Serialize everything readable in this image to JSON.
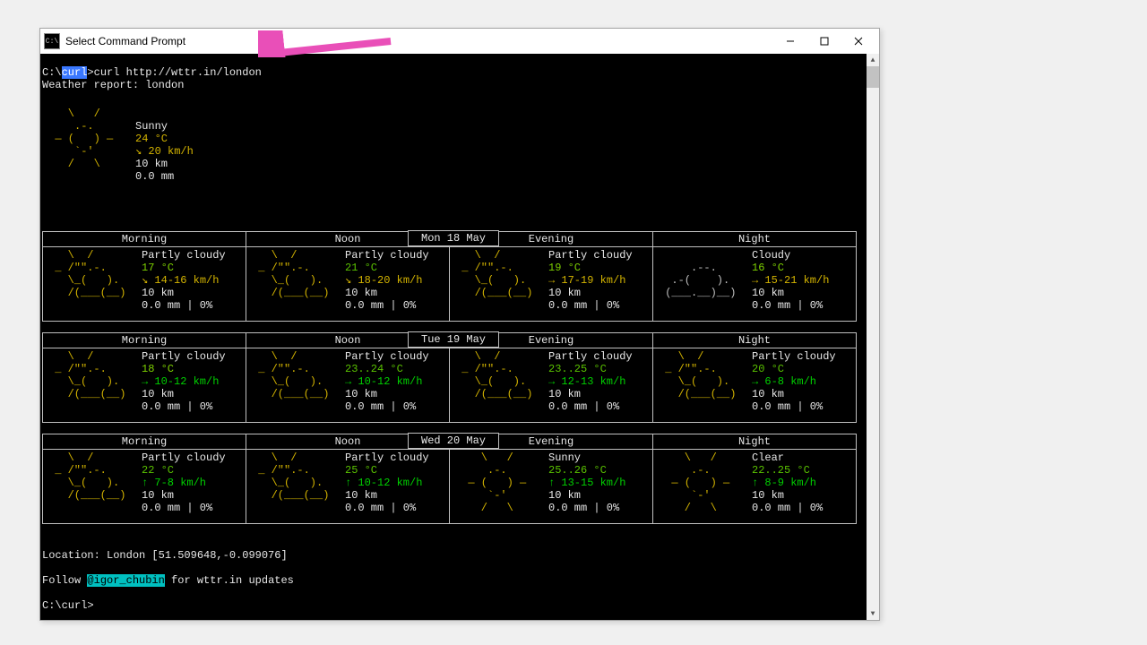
{
  "window": {
    "title": "Select Command Prompt"
  },
  "prompt": {
    "path_prefix": "C:\\",
    "selected_segment": "curl",
    "suffix": ">curl http://wttr.in/london",
    "report_header": "Weather report: london",
    "final_prompt": "C:\\curl>"
  },
  "current": {
    "ascii": "    \\   /    \n     .-.     \n  ― (   ) ―  \n     `-'     \n    /   \\    ",
    "cond": "Sunny",
    "temp": "24 °C",
    "wind": "↘ 20 km/h",
    "vis": "10 km",
    "rain": "0.0 mm"
  },
  "ascii": {
    "partly": "   \\  /      \n _ /\"\".-.    \n   \\_(   ).  \n   /(___(__) \n             ",
    "cloudy": "             \n     .--.    \n  .-(    ).  \n (___.__)__) \n             ",
    "sunny": "    \\   /    \n     .-.     \n  ― (   ) ―  \n     `-'     \n    /   \\    "
  },
  "headers": {
    "morning": "Morning",
    "noon": "Noon",
    "evening": "Evening",
    "night": "Night"
  },
  "days": [
    {
      "date": "Mon 18 May",
      "cells": [
        {
          "icon": "partly",
          "cond": "Partly cloudy",
          "tcls": "lime",
          "temp": "17 °C",
          "wcls": "yellow",
          "wind": "↘ 14-16 km/h",
          "vis": "10 km",
          "rain": "0.0 mm | 0%"
        },
        {
          "icon": "partly",
          "cond": "Partly cloudy",
          "tcls": "greenish",
          "temp": "21 °C",
          "wcls": "yellow",
          "wind": "↘ 18-20 km/h",
          "vis": "10 km",
          "rain": "0.0 mm | 0%"
        },
        {
          "icon": "partly",
          "cond": "Partly cloudy",
          "tcls": "lime",
          "temp": "19 °C",
          "wcls": "yellow",
          "wind": "→ 17-19 km/h",
          "vis": "10 km",
          "rain": "0.0 mm | 0%"
        },
        {
          "icon": "cloudy",
          "cond": "Cloudy",
          "tcls": "lime",
          "temp": "16 °C",
          "wcls": "yellow",
          "wind": "→ 15-21 km/h",
          "vis": "10 km",
          "rain": "0.0 mm | 0%"
        }
      ]
    },
    {
      "date": "Tue 19 May",
      "cells": [
        {
          "icon": "partly",
          "cond": "Partly cloudy",
          "tcls": "lime",
          "temp": "18 °C",
          "wcls": "green",
          "wind": "→ 10-12 km/h",
          "vis": "10 km",
          "rain": "0.0 mm | 0%"
        },
        {
          "icon": "partly",
          "cond": "Partly cloudy",
          "tcls": "greenish",
          "temp": "23..24 °C",
          "wcls": "green",
          "wind": "→ 10-12 km/h",
          "vis": "10 km",
          "rain": "0.0 mm | 0%"
        },
        {
          "icon": "partly",
          "cond": "Partly cloudy",
          "tcls": "greenish",
          "temp": "23..25 °C",
          "wcls": "green",
          "wind": "→ 12-13 km/h",
          "vis": "10 km",
          "rain": "0.0 mm | 0%"
        },
        {
          "icon": "partly",
          "cond": "Partly cloudy",
          "tcls": "greenish",
          "temp": "20 °C",
          "wcls": "green",
          "wind": "→ 6-8 km/h",
          "vis": "10 km",
          "rain": "0.0 mm | 0%"
        }
      ]
    },
    {
      "date": "Wed 20 May",
      "cells": [
        {
          "icon": "partly",
          "cond": "Partly cloudy",
          "tcls": "greenish",
          "temp": "22 °C",
          "wcls": "green",
          "wind": "↑ 7-8 km/h",
          "vis": "10 km",
          "rain": "0.0 mm | 0%"
        },
        {
          "icon": "partly",
          "cond": "Partly cloudy",
          "tcls": "greenish",
          "temp": "25 °C",
          "wcls": "green",
          "wind": "↑ 10-12 km/h",
          "vis": "10 km",
          "rain": "0.0 mm | 0%"
        },
        {
          "icon": "sunny",
          "cond": "Sunny",
          "tcls": "greenish",
          "temp": "25..26 °C",
          "wcls": "green",
          "wind": "↑ 13-15 km/h",
          "vis": "10 km",
          "rain": "0.0 mm | 0%"
        },
        {
          "icon": "sunny",
          "cond": "Clear",
          "tcls": "greenish",
          "temp": "22..25 °C",
          "wcls": "green",
          "wind": "↑ 8-9 km/h",
          "vis": "10 km",
          "rain": "0.0 mm | 0%"
        }
      ]
    }
  ],
  "footer": {
    "location": "Location: London [51.509648,-0.099076]",
    "follow_pre": "Follow ",
    "handle": "@igor_chubin",
    "follow_post": " for wttr.in updates"
  }
}
